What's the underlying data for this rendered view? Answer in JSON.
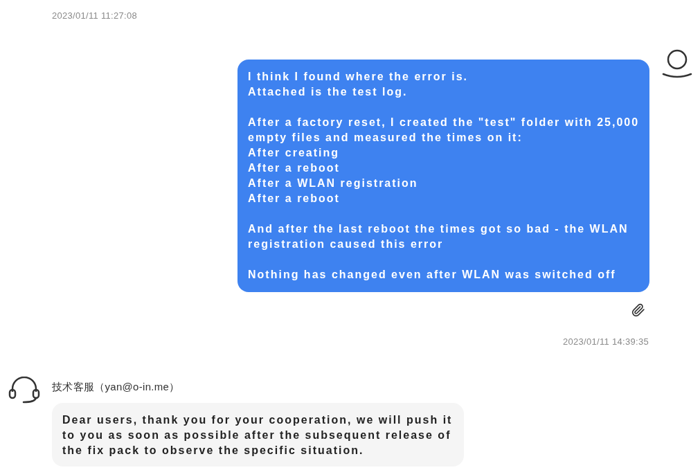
{
  "messages": [
    {
      "kind": "timestamp",
      "text": "2023/01/11 11:27:08"
    },
    {
      "kind": "user",
      "text": "I think I found where the error is.\nAttached is the test log.\n\nAfter a factory reset, I created the \"test\" folder with 25,000 empty files and measured the times on it:\nAfter creating\nAfter a reboot\nAfter a WLAN registration\nAfter a reboot\n\nAnd after the last reboot the times got so bad - the WLAN registration caused this error\n\nNothing has changed even after WLAN was switched off",
      "attachment": true
    },
    {
      "kind": "timestamp_right",
      "text": "2023/01/11 14:39:35"
    },
    {
      "kind": "agent",
      "sender": "技术客服（yan@o-in.me）",
      "text": "Dear users, thank you for your cooperation, we will push it to you as soon as possible after the subsequent release of the fix pack to observe the specific situation."
    }
  ]
}
